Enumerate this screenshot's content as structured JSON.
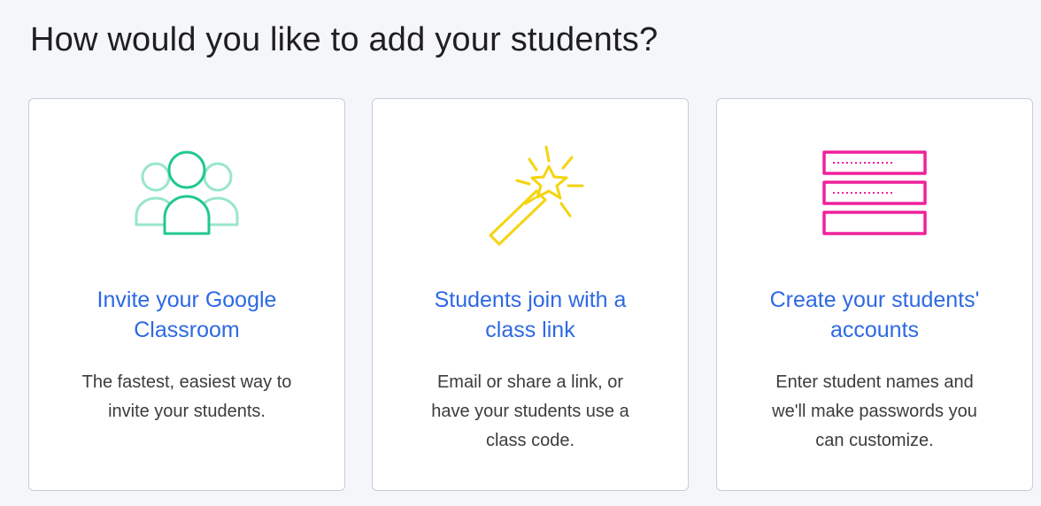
{
  "page": {
    "heading": "How would you like to add your students?"
  },
  "options": [
    {
      "icon": "group-of-people-icon",
      "title": "Invite your Google\nClassroom",
      "description": "The fastest, easiest way to\ninvite your students.",
      "icon_color": "#1fc98f"
    },
    {
      "icon": "magic-wand-icon",
      "title": "Students join with a\nclass link",
      "description": "Email or share a link, or\nhave your students use a\nclass code.",
      "icon_color": "#f5d410"
    },
    {
      "icon": "account-form-icon",
      "title": "Create your students'\naccounts",
      "description": "Enter student names and\nwe'll make passwords you\ncan customize.",
      "icon_color": "#f0219b"
    }
  ],
  "colors": {
    "title": "#2d69e3",
    "background": "#f4f6f9",
    "card_border": "#c9ced6"
  }
}
